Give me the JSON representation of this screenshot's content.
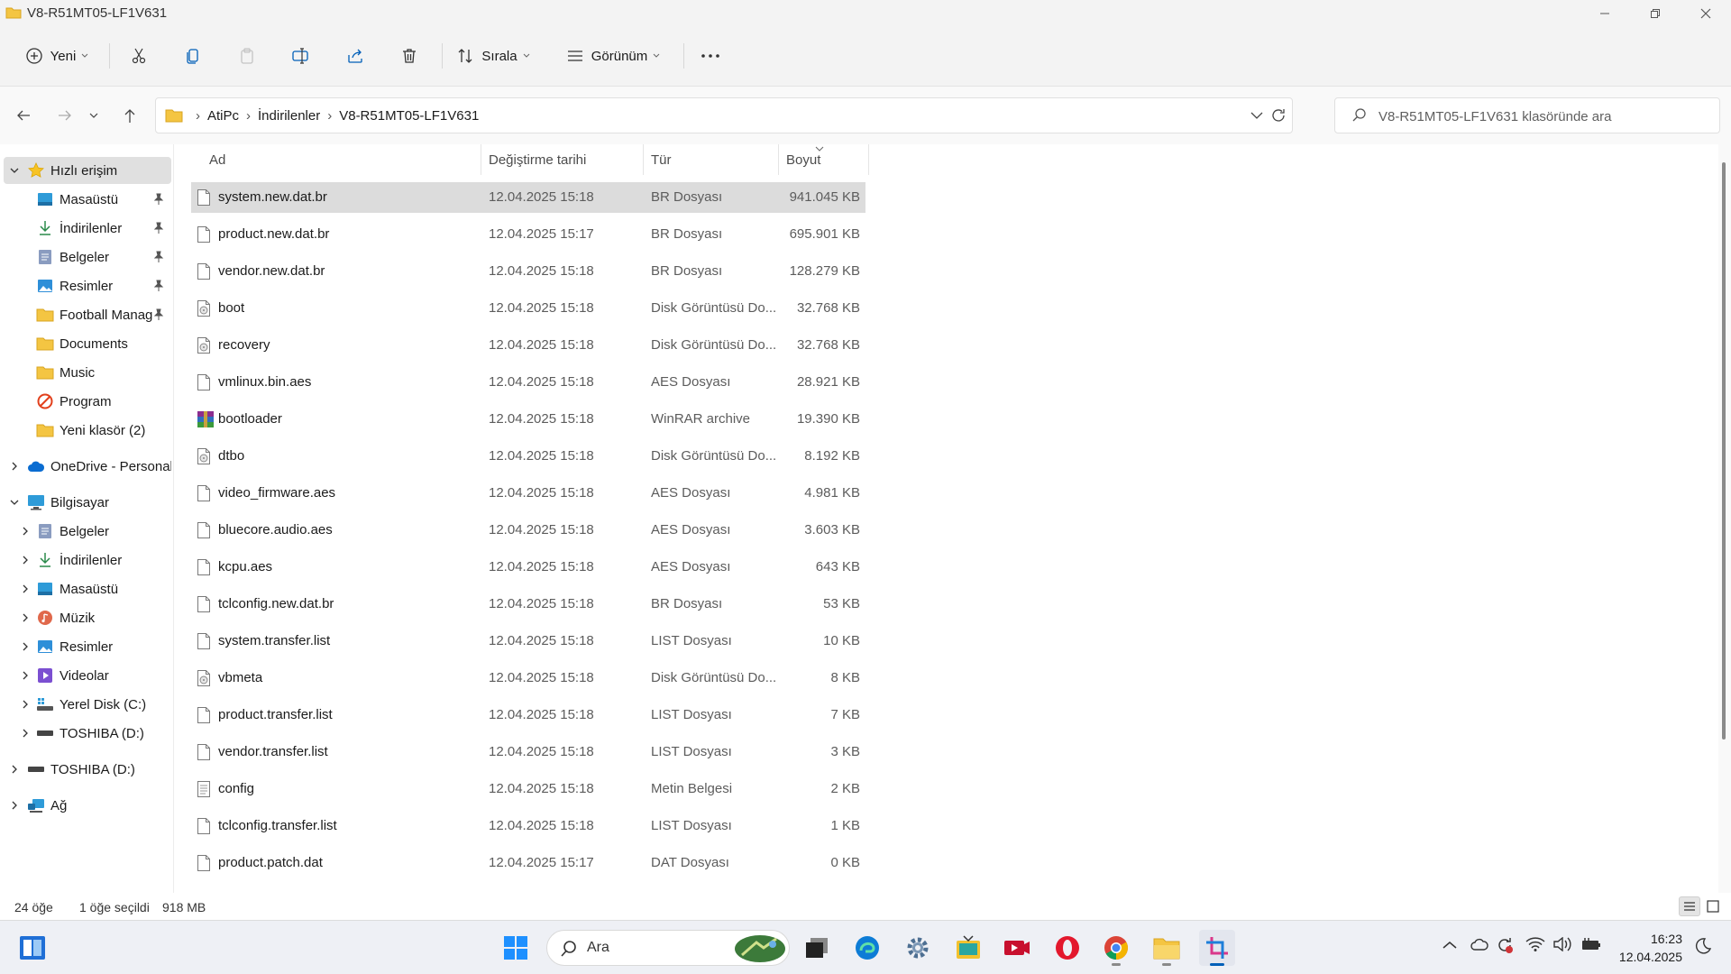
{
  "window": {
    "title": "V8-R51MT05-LF1V631"
  },
  "toolbar": {
    "new_label": "Yeni",
    "sort_label": "Sırala",
    "view_label": "Görünüm"
  },
  "address": {
    "crumbs": [
      "AtiPc",
      "İndirilenler",
      "V8-R51MT05-LF1V631"
    ]
  },
  "search": {
    "placeholder": "V8-R51MT05-LF1V631 klasöründe ara"
  },
  "sidebar": {
    "quick_access": "Hızlı erişim",
    "items": [
      "Masaüstü",
      "İndirilenler",
      "Belgeler",
      "Resimler",
      "Football Manag",
      "Documents",
      "Music",
      "Program",
      "Yeni klasör (2)"
    ],
    "onedrive": "OneDrive - Personal",
    "computer": "Bilgisayar",
    "computer_items": [
      "Belgeler",
      "İndirilenler",
      "Masaüstü",
      "Müzik",
      "Resimler",
      "Videolar",
      "Yerel Disk (C:)",
      "TOSHIBA (D:)"
    ],
    "drive": "TOSHIBA (D:)",
    "network": "Ağ"
  },
  "columns": {
    "name": "Ad",
    "date": "Değiştirme tarihi",
    "type": "Tür",
    "size": "Boyut"
  },
  "files": [
    {
      "name": "system.new.dat.br",
      "date": "12.04.2025 15:18",
      "type": "BR Dosyası",
      "size": "941.045 KB",
      "icon": "file-icon"
    },
    {
      "name": "product.new.dat.br",
      "date": "12.04.2025 15:17",
      "type": "BR Dosyası",
      "size": "695.901 KB",
      "icon": "file-icon"
    },
    {
      "name": "vendor.new.dat.br",
      "date": "12.04.2025 15:18",
      "type": "BR Dosyası",
      "size": "128.279 KB",
      "icon": "file-icon"
    },
    {
      "name": "boot",
      "date": "12.04.2025 15:18",
      "type": "Disk Görüntüsü Do...",
      "size": "32.768 KB",
      "icon": "disk-image-icon"
    },
    {
      "name": "recovery",
      "date": "12.04.2025 15:18",
      "type": "Disk Görüntüsü Do...",
      "size": "32.768 KB",
      "icon": "disk-image-icon"
    },
    {
      "name": "vmlinux.bin.aes",
      "date": "12.04.2025 15:18",
      "type": "AES Dosyası",
      "size": "28.921 KB",
      "icon": "file-icon"
    },
    {
      "name": "bootloader",
      "date": "12.04.2025 15:18",
      "type": "WinRAR archive",
      "size": "19.390 KB",
      "icon": "winrar-icon"
    },
    {
      "name": "dtbo",
      "date": "12.04.2025 15:18",
      "type": "Disk Görüntüsü Do...",
      "size": "8.192 KB",
      "icon": "disk-image-icon"
    },
    {
      "name": "video_firmware.aes",
      "date": "12.04.2025 15:18",
      "type": "AES Dosyası",
      "size": "4.981 KB",
      "icon": "file-icon"
    },
    {
      "name": "bluecore.audio.aes",
      "date": "12.04.2025 15:18",
      "type": "AES Dosyası",
      "size": "3.603 KB",
      "icon": "file-icon"
    },
    {
      "name": "kcpu.aes",
      "date": "12.04.2025 15:18",
      "type": "AES Dosyası",
      "size": "643 KB",
      "icon": "file-icon"
    },
    {
      "name": "tclconfig.new.dat.br",
      "date": "12.04.2025 15:18",
      "type": "BR Dosyası",
      "size": "53 KB",
      "icon": "file-icon"
    },
    {
      "name": "system.transfer.list",
      "date": "12.04.2025 15:18",
      "type": "LIST Dosyası",
      "size": "10 KB",
      "icon": "file-icon"
    },
    {
      "name": "vbmeta",
      "date": "12.04.2025 15:18",
      "type": "Disk Görüntüsü Do...",
      "size": "8 KB",
      "icon": "disk-image-icon"
    },
    {
      "name": "product.transfer.list",
      "date": "12.04.2025 15:18",
      "type": "LIST Dosyası",
      "size": "7 KB",
      "icon": "file-icon"
    },
    {
      "name": "vendor.transfer.list",
      "date": "12.04.2025 15:18",
      "type": "LIST Dosyası",
      "size": "3 KB",
      "icon": "file-icon"
    },
    {
      "name": "config",
      "date": "12.04.2025 15:18",
      "type": "Metin Belgesi",
      "size": "2 KB",
      "icon": "text-file-icon"
    },
    {
      "name": "tclconfig.transfer.list",
      "date": "12.04.2025 15:18",
      "type": "LIST Dosyası",
      "size": "1 KB",
      "icon": "file-icon"
    },
    {
      "name": "product.patch.dat",
      "date": "12.04.2025 15:17",
      "type": "DAT Dosyası",
      "size": "0 KB",
      "icon": "file-icon"
    }
  ],
  "status": {
    "count": "24 öğe",
    "selected": "1 öğe seçildi",
    "selected_size": "918 MB"
  },
  "taskbar": {
    "search_label": "Ara",
    "time": "16:23",
    "date": "12.04.2025"
  },
  "colors": {
    "accent": "#005fb8",
    "folder": "#f4c542",
    "selection": "#dcdcdc"
  }
}
